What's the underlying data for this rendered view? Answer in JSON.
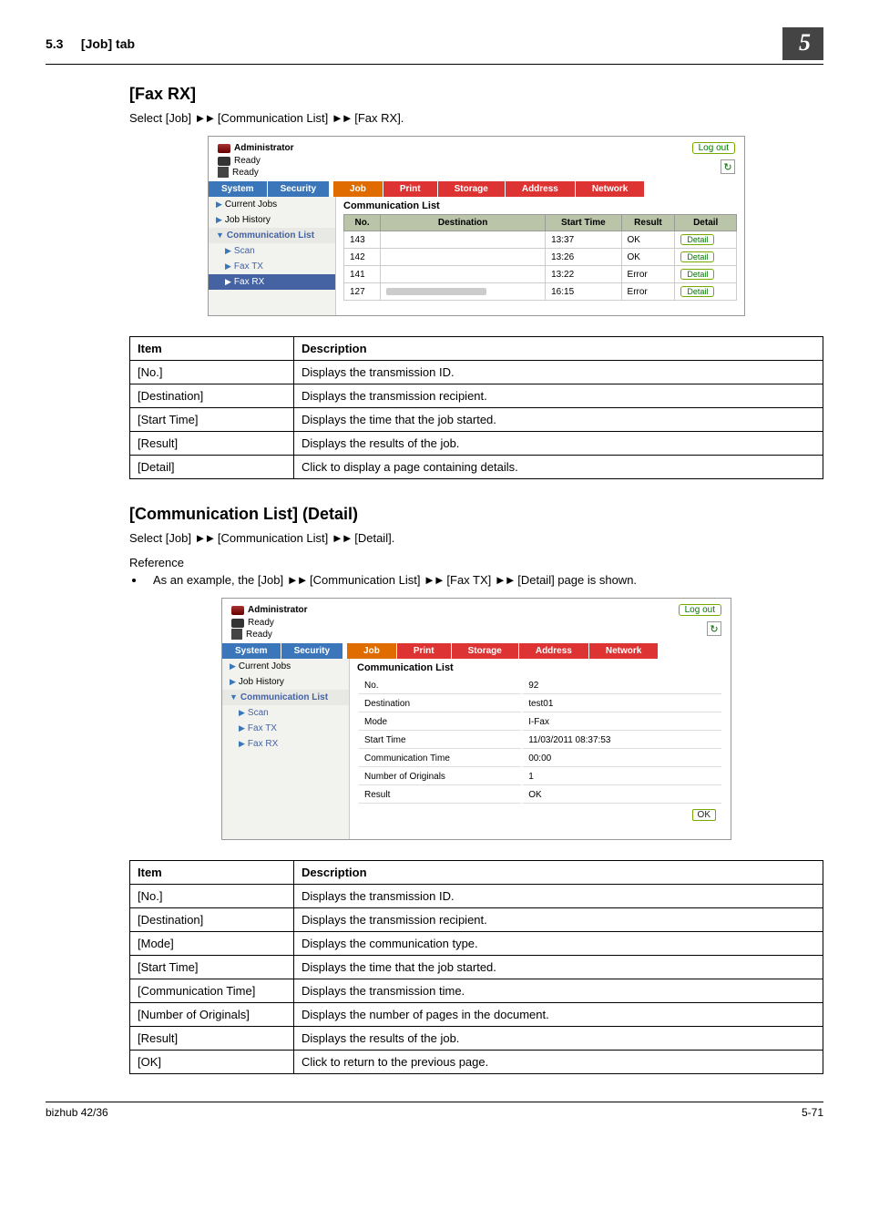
{
  "header": {
    "section": "5.3",
    "title": "[Job] tab",
    "chapter": "5"
  },
  "s1": {
    "title": "[Fax RX]",
    "intro_pre": "Select [Job] ",
    "intro_mid1": " [Communication List] ",
    "intro_post": " [Fax RX]."
  },
  "ss_common": {
    "admin": "Administrator",
    "logout": "Log out",
    "ready": "Ready",
    "nav_system": "System",
    "nav_security": "Security",
    "tab_job": "Job",
    "tab_print": "Print",
    "tab_storage": "Storage",
    "tab_address": "Address",
    "tab_network": "Network",
    "side_current": "Current Jobs",
    "side_history": "Job History",
    "side_comm": "Communication List",
    "side_scan": "Scan",
    "side_faxtx": "Fax TX",
    "side_faxrx": "Fax RX",
    "panel_title": "Communication List"
  },
  "ss1_table": {
    "h_no": "No.",
    "h_dest": "Destination",
    "h_start": "Start Time",
    "h_result": "Result",
    "h_detail": "Detail",
    "rows": [
      {
        "no": "143",
        "dest": "",
        "start": "13:37",
        "result": "OK",
        "detail": "Detail"
      },
      {
        "no": "142",
        "dest": "",
        "start": "13:26",
        "result": "OK",
        "detail": "Detail"
      },
      {
        "no": "141",
        "dest": "",
        "start": "13:22",
        "result": "Error",
        "detail": "Detail"
      },
      {
        "no": "127",
        "dest": "",
        "start": "16:15",
        "result": "Error",
        "detail": "Detail"
      }
    ]
  },
  "desc1": {
    "h_item": "Item",
    "h_desc": "Description",
    "rows": [
      {
        "item": "[No.]",
        "desc": "Displays the transmission ID."
      },
      {
        "item": "[Destination]",
        "desc": "Displays the transmission recipient."
      },
      {
        "item": "[Start Time]",
        "desc": "Displays the time that the job started."
      },
      {
        "item": "[Result]",
        "desc": "Displays the results of the job."
      },
      {
        "item": "[Detail]",
        "desc": "Click to display a page containing details."
      }
    ]
  },
  "s2": {
    "title": "[Communication List] (Detail)",
    "intro_pre": "Select [Job] ",
    "intro_mid1": " [Communication List] ",
    "intro_post": " [Detail].",
    "reference": "Reference",
    "bullet_pre": "As an example, the [Job] ",
    "bullet_mid1": " [Communication List] ",
    "bullet_mid2": " [Fax TX] ",
    "bullet_post": " [Detail] page is shown."
  },
  "ss2_detail": {
    "rows": [
      {
        "label": "No.",
        "val": "92"
      },
      {
        "label": "Destination",
        "val": "test01"
      },
      {
        "label": "Mode",
        "val": "I-Fax"
      },
      {
        "label": "Start Time",
        "val": "11/03/2011 08:37:53"
      },
      {
        "label": "Communication Time",
        "val": "00:00"
      },
      {
        "label": "Number of Originals",
        "val": "1"
      },
      {
        "label": "Result",
        "val": "OK"
      }
    ],
    "ok": "OK"
  },
  "desc2": {
    "h_item": "Item",
    "h_desc": "Description",
    "rows": [
      {
        "item": "[No.]",
        "desc": "Displays the transmission ID."
      },
      {
        "item": "[Destination]",
        "desc": "Displays the transmission recipient."
      },
      {
        "item": "[Mode]",
        "desc": "Displays the communication type."
      },
      {
        "item": "[Start Time]",
        "desc": "Displays the time that the job started."
      },
      {
        "item": "[Communication Time]",
        "desc": "Displays the transmission time."
      },
      {
        "item": "[Number of Originals]",
        "desc": "Displays the number of pages in the document."
      },
      {
        "item": "[Result]",
        "desc": "Displays the results of the job."
      },
      {
        "item": "[OK]",
        "desc": "Click to return to the previous page."
      }
    ]
  },
  "footer": {
    "product": "bizhub 42/36",
    "page": "5-71"
  }
}
